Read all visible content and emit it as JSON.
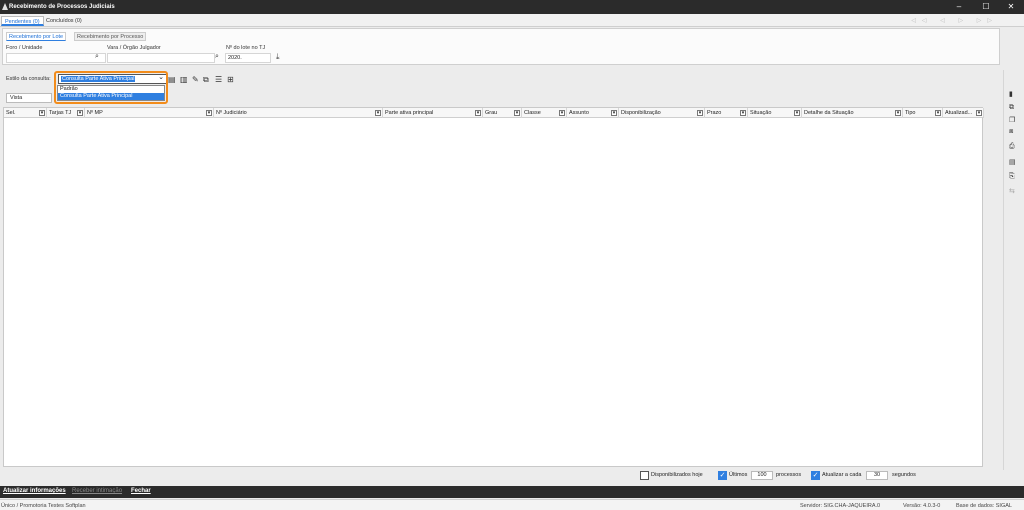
{
  "window": {
    "title": "Recebimento de Processos Judiciais",
    "minimize": "–",
    "maximize": "☐",
    "close": "✕"
  },
  "top_tabs": [
    {
      "label": "Pendentes (0)",
      "active": true
    },
    {
      "label": "Concluídos (0)",
      "active": false
    }
  ],
  "sub_tabs": [
    {
      "label": "Recebimento por Lote",
      "active": true
    },
    {
      "label": "Recebimento por Processo",
      "active": false
    }
  ],
  "filters": {
    "foro_label": "Foro / Unidade",
    "foro_value": "",
    "vara_label": "Vara / Órgão Julgador",
    "vara_value": "",
    "lote_label": "Nº do lote no TJ",
    "lote_value": "2020."
  },
  "consulta": {
    "label": "Estilo da consulta:",
    "selected": "Consulta Parte Ativa Principal",
    "options": [
      "Padrão",
      "Consulta Parte Ativa Principal"
    ]
  },
  "vista": {
    "value": "Vista"
  },
  "grid": {
    "columns": [
      "Sel.",
      "Tarjas TJ",
      "Nº MP",
      "Nº Judiciário",
      "Parte ativa principal",
      "Grau",
      "Classe",
      "Assunto",
      "Disponibilização",
      "Prazo",
      "Situação",
      "Detalhe da Situação",
      "Tipo",
      "Atualizad..."
    ]
  },
  "bottom_options": {
    "disponibilizados_label": "Disponibilizados hoje",
    "disponibilizados_checked": false,
    "ultimos_label": "Últimos",
    "ultimos_checked": true,
    "ultimos_value": "100",
    "processos_label": "processos",
    "atualizar_label": "Atualizar a cada",
    "atualizar_checked": true,
    "atualizar_value": "30",
    "segundos_label": "segundos"
  },
  "actions": [
    {
      "label": "Atualizar informações",
      "enabled": true
    },
    {
      "label": "Receber intimação",
      "enabled": false
    },
    {
      "label": "Fechar",
      "enabled": true
    }
  ],
  "status": {
    "left": "Único / Promotoria Testes Softplan",
    "server": "Servidor: SIG.CHA-JAQUEIRA.0",
    "version": "Versão: 4.0.3-0",
    "database": "Base de dados: SIGAL"
  }
}
